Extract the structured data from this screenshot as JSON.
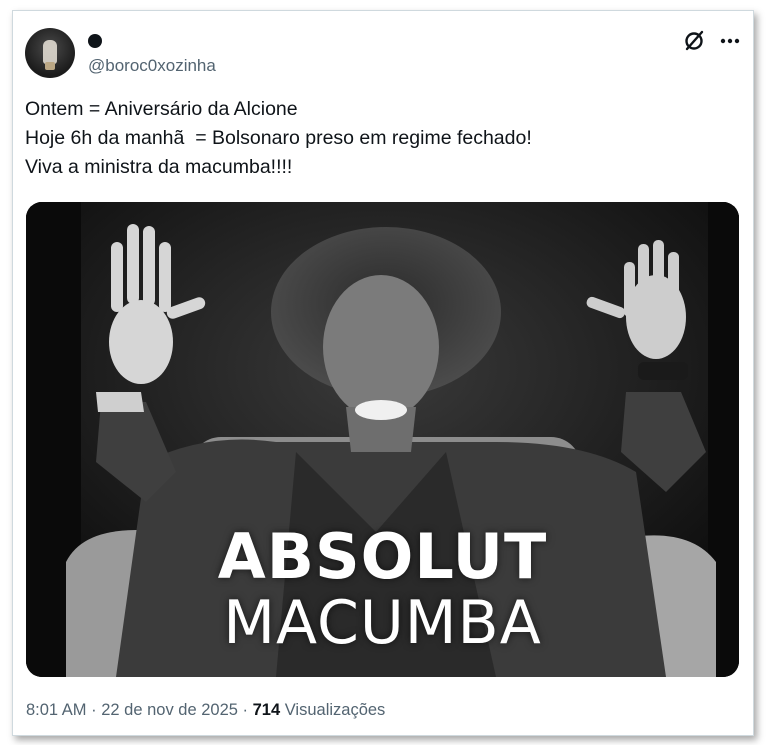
{
  "header": {
    "handle": "@boroc0xozinha",
    "avatar_icon": "profile-photo",
    "grok_icon": "grok-icon",
    "more_icon": "more-icon"
  },
  "tweet": {
    "lines": [
      "Ontem = Aniversário da Alcione",
      "Hoje 6h da manhã  = Bolsonaro preso em regime fechado!",
      "Viva a ministra da macumba!!!!"
    ],
    "image": {
      "caption_line1": "ABSOLUT",
      "caption_line2": "MACUMBA"
    }
  },
  "meta": {
    "time": "8:01 AM",
    "separator": " · ",
    "date": "22 de nov de 2025",
    "views_count": "714",
    "views_label": " Visualizações"
  },
  "colors": {
    "text": "#0f1419",
    "secondary": "#536471",
    "border": "#cfd9de"
  }
}
